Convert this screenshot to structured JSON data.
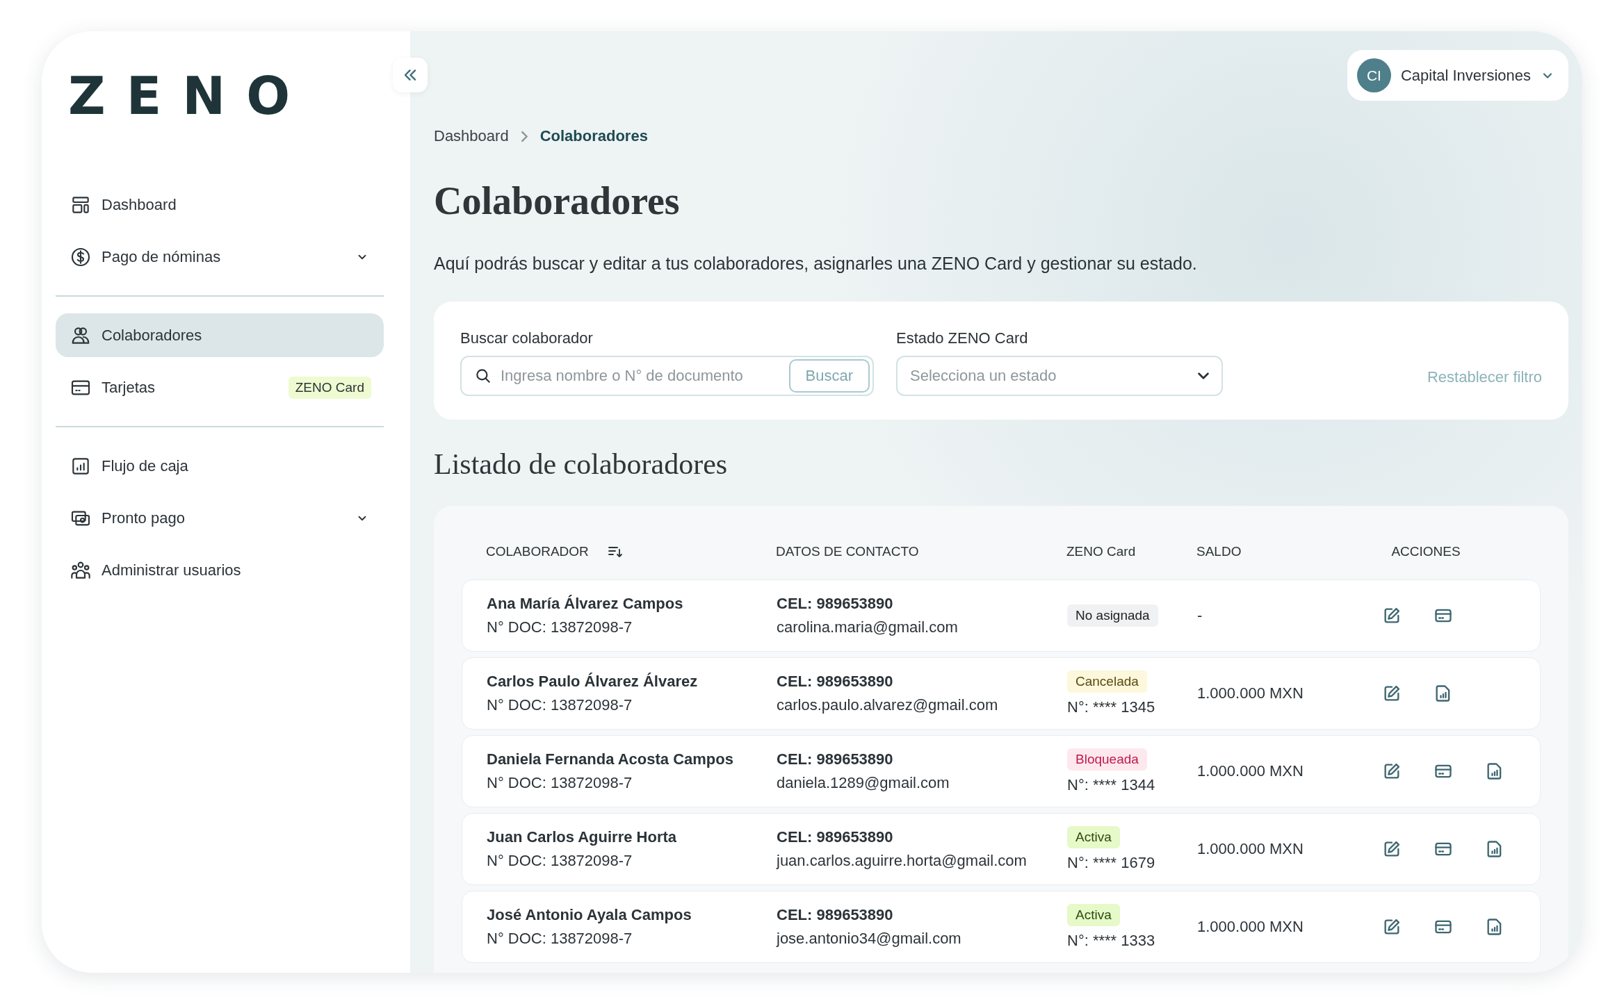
{
  "brand": {
    "logo": "ZENO"
  },
  "sidebar": {
    "groups": [
      [
        {
          "label": "Dashboard",
          "kind": "link",
          "selected": false
        },
        {
          "label": "Pago de nóminas",
          "kind": "expandable",
          "selected": false
        }
      ],
      [
        {
          "label": "Colaboradores",
          "kind": "link",
          "selected": true
        },
        {
          "label": "Tarjetas",
          "kind": "link",
          "selected": false,
          "badge": "ZENO Card"
        }
      ],
      [
        {
          "label": "Flujo de caja",
          "kind": "link",
          "selected": false
        },
        {
          "label": "Pronto pago",
          "kind": "expandable",
          "selected": false
        },
        {
          "label": "Administrar usuarios",
          "kind": "link",
          "selected": false
        }
      ]
    ]
  },
  "account": {
    "initials": "CI",
    "name": "Capital Inversiones"
  },
  "breadcrumb": [
    {
      "label": "Dashboard",
      "selected": false
    },
    {
      "label": "Colaboradores",
      "selected": true
    }
  ],
  "page": {
    "title": "Colaboradores",
    "description": "Aquí podrás buscar y editar a tus colaboradores, asignarles una ZENO Card y gestionar su estado."
  },
  "filters": {
    "search": {
      "label": "Buscar colaborador",
      "placeholder": "Ingresa nombre o N° de documento",
      "button": "Buscar"
    },
    "status": {
      "label": "Estado ZENO Card",
      "placeholder": "Selecciona un estado"
    },
    "reset": "Restablecer filtro"
  },
  "list": {
    "title": "Listado de colaboradores",
    "columns": [
      "COLABORADOR",
      "DATOS DE CONTACTO",
      "ZENO Card",
      "SALDO",
      "ACCIONES"
    ],
    "rows": [
      {
        "name": "Ana María Álvarez Campos",
        "doc": "N° DOC:  13872098-7",
        "phone": "CEL: 989653890",
        "email": "carolina.maria@gmail.com",
        "card_status": {
          "label": "No asignada",
          "kind": "none"
        },
        "balance": "-",
        "actions": [
          {
            "kind": "edit"
          },
          {
            "kind": "card"
          }
        ]
      },
      {
        "name": "Carlos Paulo Álvarez Álvarez",
        "doc": "N° DOC:  13872098-7",
        "phone": "CEL: 989653890",
        "email": "carlos.paulo.alvarez@gmail.com",
        "card_status": {
          "label": "Cancelada",
          "kind": "cancelled"
        },
        "card_number": "N°: **** 1345",
        "balance": "1.000.000 MXN",
        "actions": [
          {
            "kind": "edit"
          },
          {
            "kind": "report"
          }
        ]
      },
      {
        "name": "Daniela Fernanda Acosta Campos",
        "doc": "N° DOC:  13872098-7",
        "phone": "CEL: 989653890",
        "email": "daniela.1289@gmail.com",
        "card_status": {
          "label": "Bloqueada",
          "kind": "blocked"
        },
        "card_number": "N°: **** 1344",
        "balance": "1.000.000 MXN",
        "actions": [
          {
            "kind": "edit"
          },
          {
            "kind": "card"
          },
          {
            "kind": "report"
          }
        ]
      },
      {
        "name": "Juan Carlos Aguirre Horta",
        "doc": "N° DOC:  13872098-7",
        "phone": "CEL: 989653890",
        "email": "juan.carlos.aguirre.horta@gmail.com",
        "card_status": {
          "label": "Activa",
          "kind": "active"
        },
        "card_number": "N°: **** 1679",
        "balance": "1.000.000 MXN",
        "actions": [
          {
            "kind": "edit"
          },
          {
            "kind": "card"
          },
          {
            "kind": "report"
          }
        ]
      },
      {
        "name": "José Antonio Ayala Campos",
        "doc": "N° DOC:  13872098-7",
        "phone": "CEL: 989653890",
        "email": "jose.antonio34@gmail.com",
        "card_status": {
          "label": "Activa",
          "kind": "active"
        },
        "card_number": "N°: **** 1333",
        "balance": "1.000.000 MXN",
        "actions": [
          {
            "kind": "edit"
          },
          {
            "kind": "card"
          },
          {
            "kind": "report"
          }
        ]
      }
    ]
  }
}
